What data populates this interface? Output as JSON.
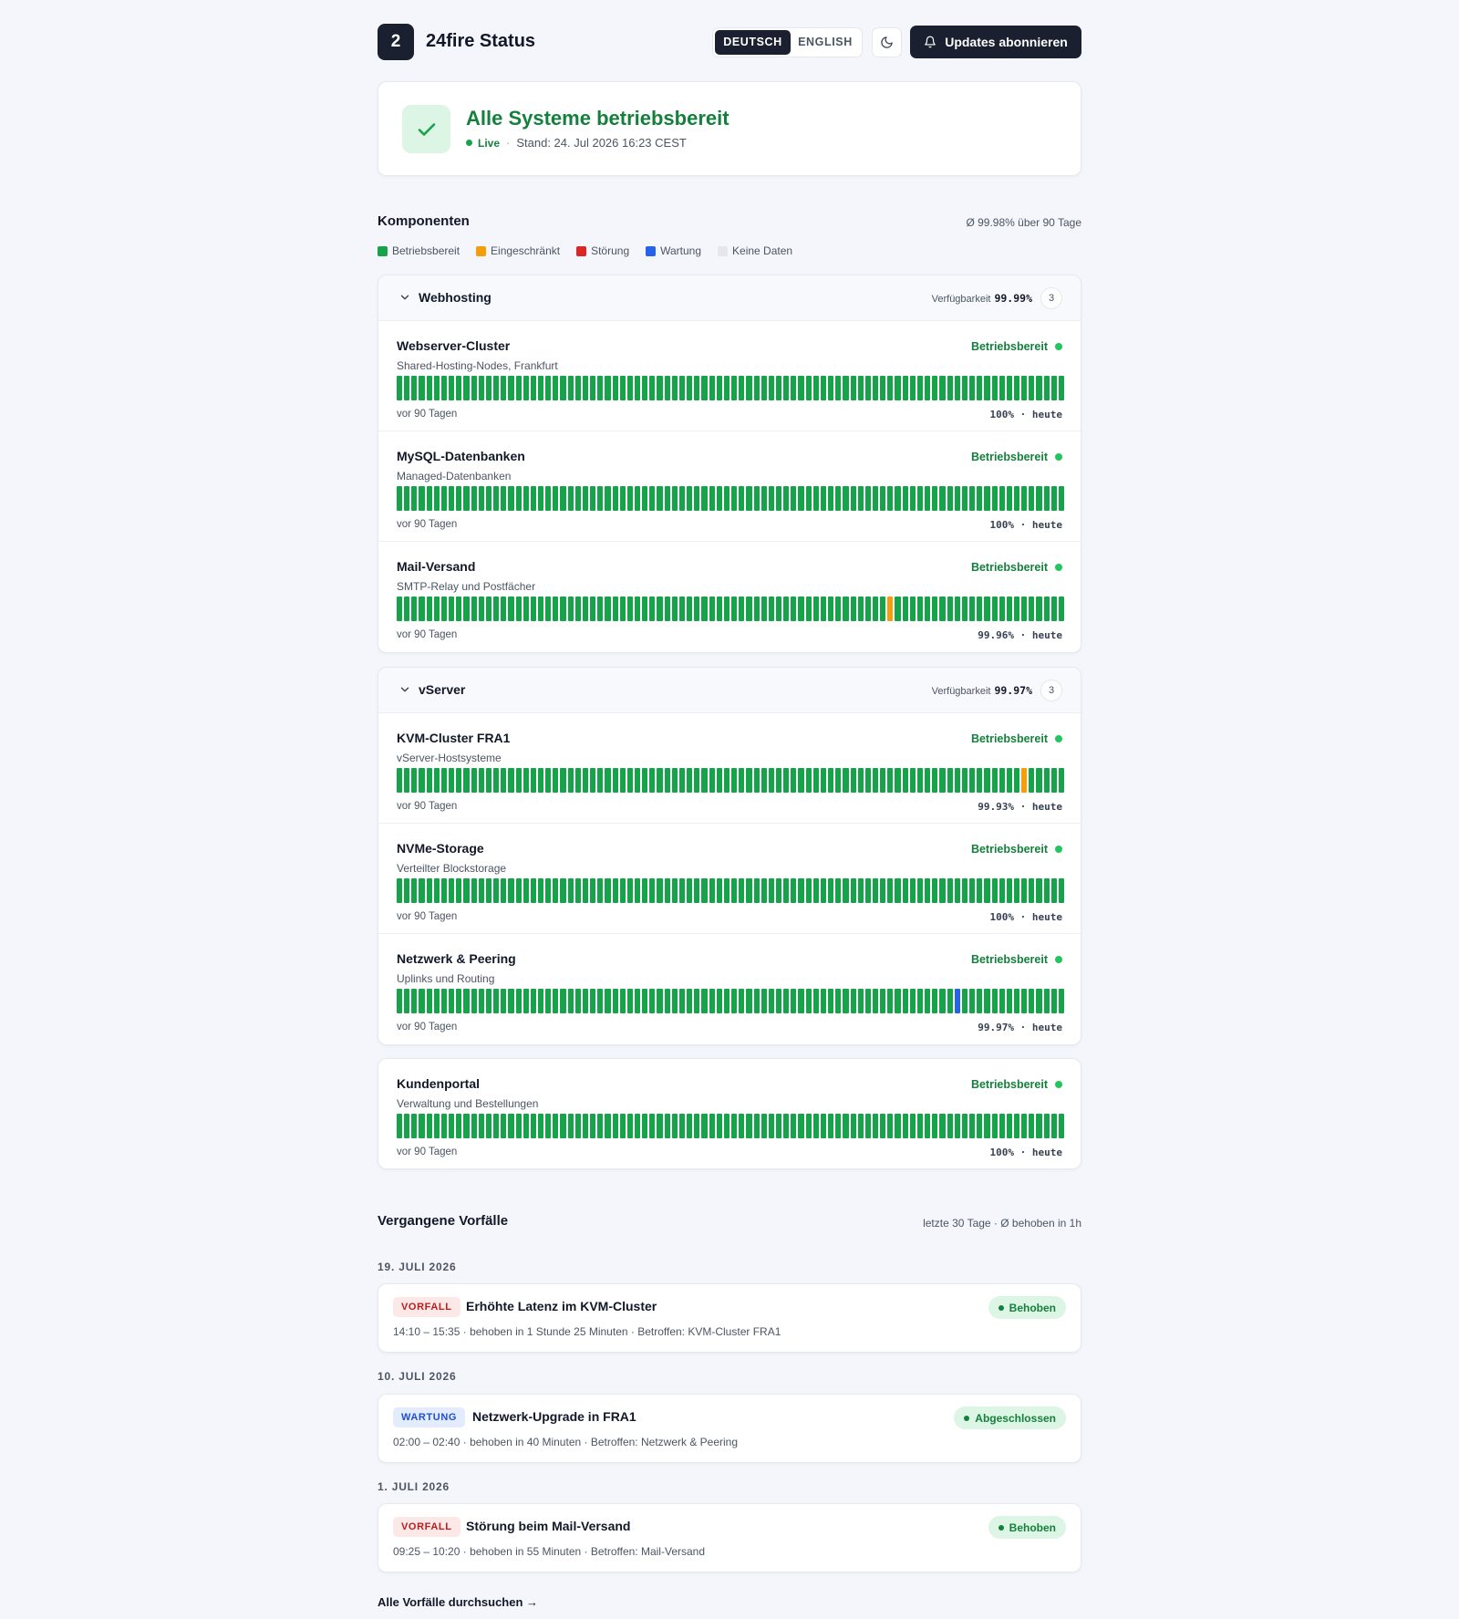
{
  "header": {
    "logo": "2",
    "title": "24fire Status",
    "lang_de": "DEUTSCH",
    "lang_en": "ENGLISH",
    "subscribe": "Updates abonnieren"
  },
  "overall": {
    "title": "Alle Systeme betriebsbereit",
    "live": "Live",
    "sep": "·",
    "stand": "Stand: 24. Jul 2026 16:23 CEST"
  },
  "components": {
    "title": "Komponenten",
    "average": "Ø 99.98% über 90 Tage",
    "legend": [
      {
        "label": "Betriebsbereit",
        "color": "#16a34a"
      },
      {
        "label": "Eingeschränkt",
        "color": "#f59e0b"
      },
      {
        "label": "Störung",
        "color": "#dc2626"
      },
      {
        "label": "Wartung",
        "color": "#2563eb"
      },
      {
        "label": "Keine Daten",
        "color": "#e5e7eb"
      }
    ],
    "bar_colors": {
      "ok": "#16a34a",
      "degraded": "#f59e0b",
      "outage": "#dc2626",
      "maintenance": "#2563eb",
      "nodata": "#e5e7eb"
    },
    "groups": [
      {
        "name": "Webhosting",
        "availability_label": "Verfügbarkeit",
        "availability": "99.99%",
        "count": "3",
        "items": [
          {
            "name": "Webserver-Cluster",
            "desc": "Shared-Hosting-Nodes, Frankfurt",
            "status": "Betriebsbereit",
            "left": "vor 90 Tagen",
            "right": "100% · heute",
            "days": 90,
            "events": []
          },
          {
            "name": "MySQL-Datenbanken",
            "desc": "Managed-Datenbanken",
            "status": "Betriebsbereit",
            "left": "vor 90 Tagen",
            "right": "100% · heute",
            "days": 90,
            "events": []
          },
          {
            "name": "Mail-Versand",
            "desc": "SMTP-Relay und Postfächer",
            "status": "Betriebsbereit",
            "left": "vor 90 Tagen",
            "right": "99.96% · heute",
            "days": 90,
            "events": [
              {
                "day": 66,
                "type": "degraded"
              }
            ]
          }
        ]
      },
      {
        "name": "vServer",
        "availability_label": "Verfügbarkeit",
        "availability": "99.97%",
        "count": "3",
        "items": [
          {
            "name": "KVM-Cluster FRA1",
            "desc": "vServer-Hostsysteme",
            "status": "Betriebsbereit",
            "left": "vor 90 Tagen",
            "right": "99.93% · heute",
            "days": 90,
            "events": [
              {
                "day": 84,
                "type": "degraded"
              }
            ]
          },
          {
            "name": "NVMe-Storage",
            "desc": "Verteilter Blockstorage",
            "status": "Betriebsbereit",
            "left": "vor 90 Tagen",
            "right": "100% · heute",
            "days": 90,
            "events": []
          },
          {
            "name": "Netzwerk & Peering",
            "desc": "Uplinks und Routing",
            "status": "Betriebsbereit",
            "left": "vor 90 Tagen",
            "right": "99.97% · heute",
            "days": 90,
            "events": [
              {
                "day": 75,
                "type": "maintenance"
              }
            ]
          }
        ]
      }
    ],
    "standalone": {
      "name": "Kundenportal",
      "desc": "Verwaltung und Bestellungen",
      "status": "Betriebsbereit",
      "left": "vor 90 Tagen",
      "right": "100% · heute",
      "days": 90,
      "events": []
    }
  },
  "incidents": {
    "title": "Vergangene Vorfälle",
    "summary": "letzte 30 Tage · Ø behoben in 1h",
    "days": [
      {
        "date": "19. JULI 2026",
        "tag": "VORFALL",
        "title": "Erhöhte Latenz im KVM-Cluster",
        "meta": "14:10 – 15:35 · behoben in 1 Stunde 25 Minuten · Betroffen: KVM-Cluster FRA1",
        "status": "Behoben"
      },
      {
        "date": "10. JULI 2026",
        "tag": "WARTUNG",
        "title": "Netzwerk-Upgrade in FRA1",
        "meta": "02:00 – 02:40 · behoben in 40 Minuten · Betroffen: Netzwerk & Peering",
        "status": "Abgeschlossen"
      },
      {
        "date": "1. JULI 2026",
        "tag": "VORFALL",
        "title": "Störung beim Mail-Versand",
        "meta": "09:25 – 10:20 · behoben in 55 Minuten · Betroffen: Mail-Versand",
        "status": "Behoben"
      }
    ],
    "all_link": "Alle Vorfälle durchsuchen →"
  }
}
